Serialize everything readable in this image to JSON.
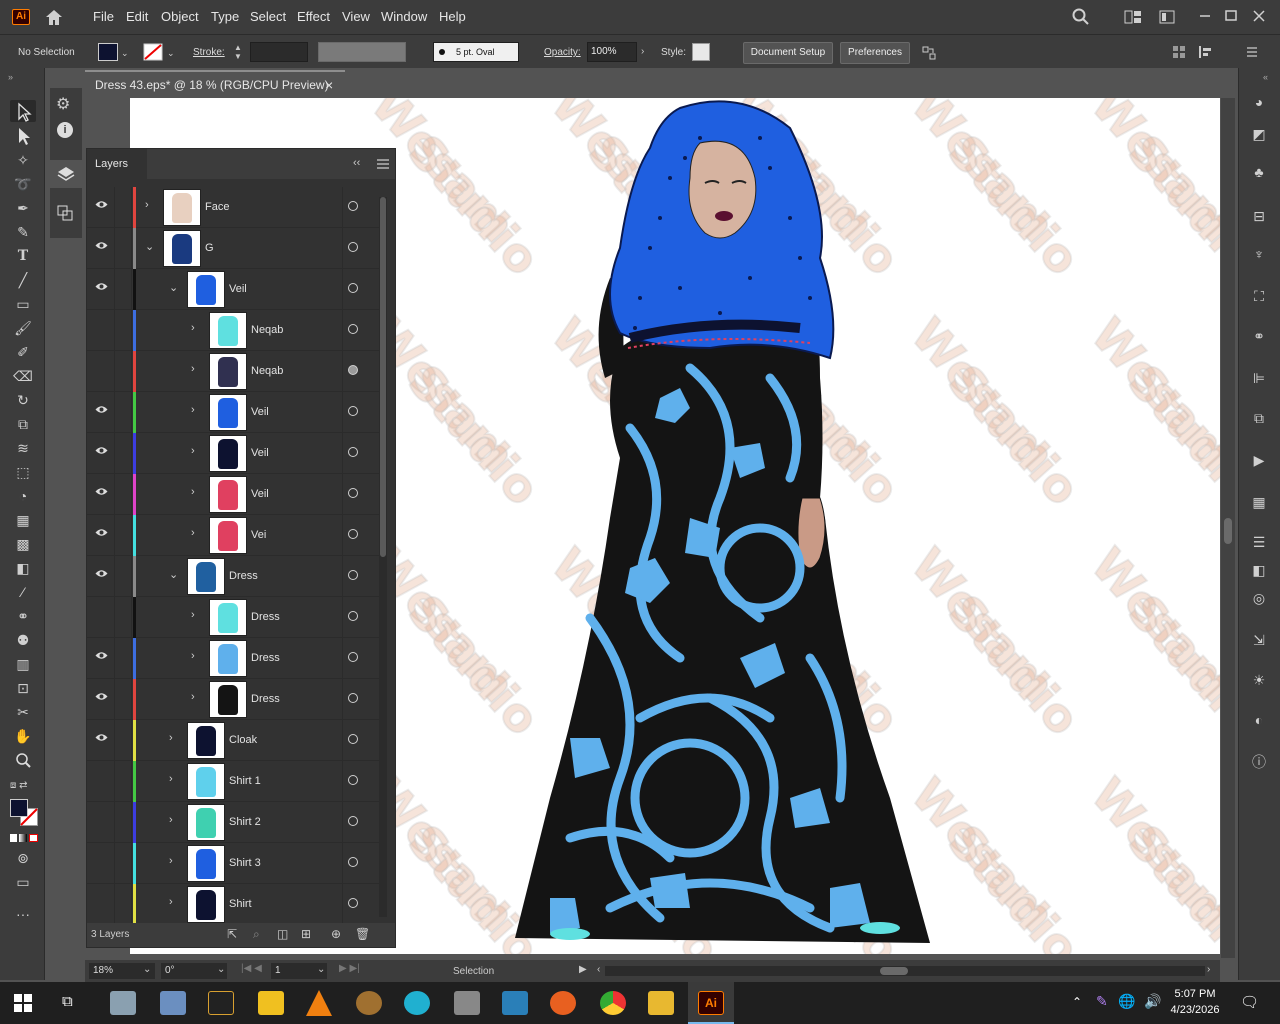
{
  "app": {
    "logo": "Ai"
  },
  "menu": [
    "File",
    "Edit",
    "Object",
    "Type",
    "Select",
    "Effect",
    "View",
    "Window",
    "Help"
  ],
  "control_bar": {
    "selection": "No Selection",
    "stroke_label": "Stroke:",
    "brush": "5 pt. Oval",
    "opacity_label": "Opacity:",
    "opacity_value": "100%",
    "style_label": "Style:",
    "document_setup": "Document Setup",
    "preferences": "Preferences"
  },
  "document": {
    "tab_title": "Dress 43.eps* @ 18 % (RGB/CPU Preview)",
    "close": "×"
  },
  "layers_panel": {
    "title": "Layers",
    "collapse": "‹‹",
    "footer_count": "3 Layers",
    "rows": [
      {
        "name": "Face",
        "visible": true,
        "indent": 0,
        "expanded": false,
        "color": "#e0453f",
        "filled": false
      },
      {
        "name": "G",
        "visible": true,
        "indent": 0,
        "expanded": true,
        "color": "#8a8a8a",
        "filled": false
      },
      {
        "name": "Veil",
        "visible": true,
        "indent": 1,
        "expanded": true,
        "color": "#111111",
        "filled": false
      },
      {
        "name": "Neqab",
        "visible": false,
        "indent": 2,
        "expanded": false,
        "color": "#3d6ee0",
        "filled": false
      },
      {
        "name": "Neqab",
        "visible": false,
        "indent": 2,
        "expanded": false,
        "color": "#e0453f",
        "filled": true
      },
      {
        "name": "Veil",
        "visible": true,
        "indent": 2,
        "expanded": false,
        "color": "#44c944",
        "filled": false
      },
      {
        "name": "Veil",
        "visible": true,
        "indent": 2,
        "expanded": false,
        "color": "#3d3de0",
        "filled": false
      },
      {
        "name": "Veil",
        "visible": true,
        "indent": 2,
        "expanded": false,
        "color": "#e044c9",
        "filled": false
      },
      {
        "name": "Vei",
        "visible": true,
        "indent": 2,
        "expanded": false,
        "color": "#44e0e0",
        "filled": false
      },
      {
        "name": "Dress",
        "visible": true,
        "indent": 1,
        "expanded": true,
        "color": "#8a8a8a",
        "filled": false
      },
      {
        "name": "Dress",
        "visible": false,
        "indent": 2,
        "expanded": false,
        "color": "#111111",
        "filled": false
      },
      {
        "name": "Dress",
        "visible": true,
        "indent": 2,
        "expanded": false,
        "color": "#3d6ee0",
        "filled": false
      },
      {
        "name": "Dress",
        "visible": true,
        "indent": 2,
        "expanded": false,
        "color": "#e0453f",
        "filled": false
      },
      {
        "name": "Cloak",
        "visible": true,
        "indent": 1,
        "expanded": false,
        "color": "#e0e044",
        "filled": false
      },
      {
        "name": "Shirt 1",
        "visible": false,
        "indent": 1,
        "expanded": false,
        "color": "#44c944",
        "filled": false
      },
      {
        "name": "Shirt 2",
        "visible": false,
        "indent": 1,
        "expanded": false,
        "color": "#3d3de0",
        "filled": false
      },
      {
        "name": "Shirt 3",
        "visible": false,
        "indent": 1,
        "expanded": false,
        "color": "#44e0e0",
        "filled": false
      },
      {
        "name": "Shirt",
        "visible": false,
        "indent": 1,
        "expanded": false,
        "color": "#e0e044",
        "filled": false
      }
    ]
  },
  "status_bar": {
    "zoom": "18%",
    "rotation": "0°",
    "artboard": "1",
    "tool": "Selection"
  },
  "watermark": [
    "Wesam",
    "Studio"
  ],
  "taskbar": {
    "time": "5:07 PM",
    "date": "4/23/2026"
  },
  "colors": {
    "ui_dark": "#3c3c3c",
    "ui_mid": "#535353",
    "accent_ai": "#ff7c00",
    "hair": "#1f5fe0",
    "dress_black": "#141414",
    "dress_pattern": "#5fb0ec"
  }
}
